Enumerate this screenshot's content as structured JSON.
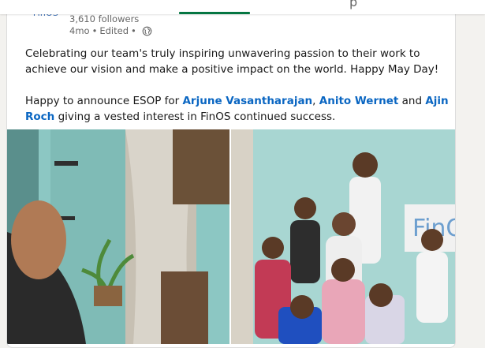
{
  "post": {
    "company_logo_text": "FinOS",
    "followers": "3,610 followers",
    "time": "4mo",
    "edited": "Edited",
    "paragraph1": "Celebrating our team's truly inspiring unwavering passion to their work to achieve our vision and make a positive impact on the world. Happy May Day!",
    "p2_intro": "Happy to announce ESOP for",
    "mentions": [
      "Arjune Vasantharajan",
      "Anito Wernet",
      "Ajin Roch"
    ],
    "p2_sep": ",",
    "p2_and": "and",
    "p2_end": "giving a vested interest in FinOS continued success.",
    "photo_sign_text": "FinOS"
  },
  "colors": {
    "link": "#0a66c2",
    "nav_active": "#057642",
    "wall": "#a9d7d3"
  },
  "icons": [
    "globe-icon"
  ]
}
